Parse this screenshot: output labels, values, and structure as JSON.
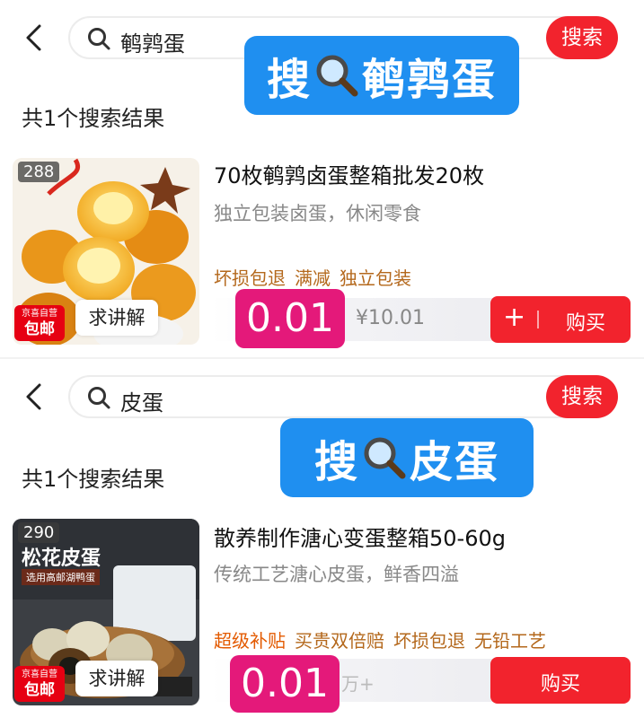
{
  "screens": [
    {
      "search": {
        "query": "鹌鹑蛋",
        "button": "搜索"
      },
      "overlay": {
        "prefix": "搜",
        "word": "鹌鹑蛋"
      },
      "result_count": "共1个搜索结果",
      "product": {
        "thumb_count": "288",
        "badge_top": "京喜自营",
        "badge_bottom": "包邮",
        "ask_label": "求讲解",
        "title": "70枚鹌鹑卤蛋整箱批发20枚",
        "subtitle": "独立包装卤蛋，休闲零食",
        "tags": [
          "坏损包退",
          "满减",
          "独立包装"
        ],
        "price": "0.01",
        "original_price": "¥10.01",
        "add_icon": "+",
        "buy_label": "购买"
      }
    },
    {
      "search": {
        "query": "皮蛋",
        "button": "搜索"
      },
      "overlay": {
        "prefix": "搜",
        "word": "皮蛋"
      },
      "result_count": "共1个搜索结果",
      "product": {
        "thumb_count": "290",
        "thumb_text_1": "松花皮蛋",
        "thumb_text_2": "选用高邮湖鸭蛋",
        "badge_top": "京喜自营",
        "badge_bottom": "包邮",
        "ask_label": "求讲解",
        "title": "散养制作溏心变蛋整箱50-60g",
        "subtitle": "传统工艺溏心皮蛋，鲜香四溢",
        "tags": [
          "超级补贴",
          "买贵双倍赔",
          "坏损包退",
          "无铅工艺"
        ],
        "price": "0.01",
        "faint_text": "万+",
        "buy_label": "购买"
      }
    }
  ],
  "colors": {
    "red": "#f2232d",
    "overlay_blue": "#1f8ff0",
    "price_pink": "#e4197a",
    "tag_brown": "#b4681c"
  }
}
